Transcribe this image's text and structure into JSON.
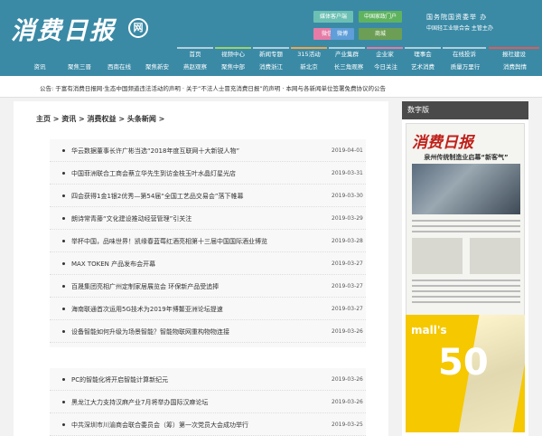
{
  "header": {
    "logo_text": "消费日报",
    "logo_badge": "网",
    "buttons": [
      "媒体客户端",
      "中国家政门户",
      "微信",
      "微博",
      "商城"
    ],
    "sponsor_line1": "国务院国资委举  办",
    "sponsor_line2": "中国轻工业联合会  主管主办"
  },
  "nav": {
    "row1": [
      "首页",
      "视频中心",
      "新闻专题",
      "315活动",
      "产业集群",
      "企业家",
      "理事会",
      "在线投诉",
      "报社建设"
    ],
    "row2": [
      "资讯",
      "聚焦三晋",
      "西南在线",
      "聚焦新安",
      "燕赵观察",
      "聚焦中部",
      "消费浙江",
      "新北京",
      "长三角观察",
      "今日关注",
      "艺术消费",
      "质量万里行",
      "消费舆情"
    ]
  },
  "notice": "公告: 于富有消费日报网·生态中国频道违法活动的声明   · 关于“不法人士冒充消费日报”的声明   · 本网与各新闻单位签署免费协议的公告",
  "breadcrumb": "主页 > 资讯 > 消费权益 > 头条新闻 >",
  "list_a": [
    {
      "title": "华云数据董事长许广彬当选“2018年度互联网十大新锐人物”",
      "date": "2019-04-01"
    },
    {
      "title": "中国菲洲联合工商会蔡立华先生到访金枝玉叶水晶灯星光店",
      "date": "2019-03-31"
    },
    {
      "title": "四会获得1金1银2优秀—第54届“全国工艺品交易会”落下帷幕",
      "date": "2019-03-30"
    },
    {
      "title": "朗诗常青藤“文化建设推动经营管理”引关注",
      "date": "2019-03-29"
    },
    {
      "title": "举杯中国，品味世界！凯缘春蓝莓红酒亮相第十三届中国国际酒业博览",
      "date": "2019-03-28"
    },
    {
      "title": "MAX TOKEN 产品发布会开幕",
      "date": "2019-03-27"
    },
    {
      "title": "百晟集团亮相广州定制家居展览会 环保新产品受追捧",
      "date": "2019-03-27"
    },
    {
      "title": "海南联通首次运用5G技术为2019年博鳌亚洲论坛提速",
      "date": "2019-03-27"
    },
    {
      "title": "设备智能如何升级为场景智能？智能物联网重构物物连接",
      "date": "2019-03-26"
    }
  ],
  "list_b": [
    {
      "title": "PC的智能化将开启智能计算新纪元",
      "date": "2019-03-26"
    },
    {
      "title": "黑龙江大力支持汉麻产业7月将举办国际汉麻论坛",
      "date": "2019-03-26"
    },
    {
      "title": "中共深圳市川渝商会联合委员会（筹）第一次党员大会成功举行",
      "date": "2019-03-25"
    }
  ],
  "sidebar": {
    "title": "数字版",
    "paper_masthead": "消费日报",
    "paper_headline": "泉州传统制造业启幕“新客气”",
    "ad_brand": "mall's",
    "ad_number": "50"
  },
  "colors": {
    "header_bg": "#3a8aa6",
    "ad_yellow": "#f5c800"
  }
}
